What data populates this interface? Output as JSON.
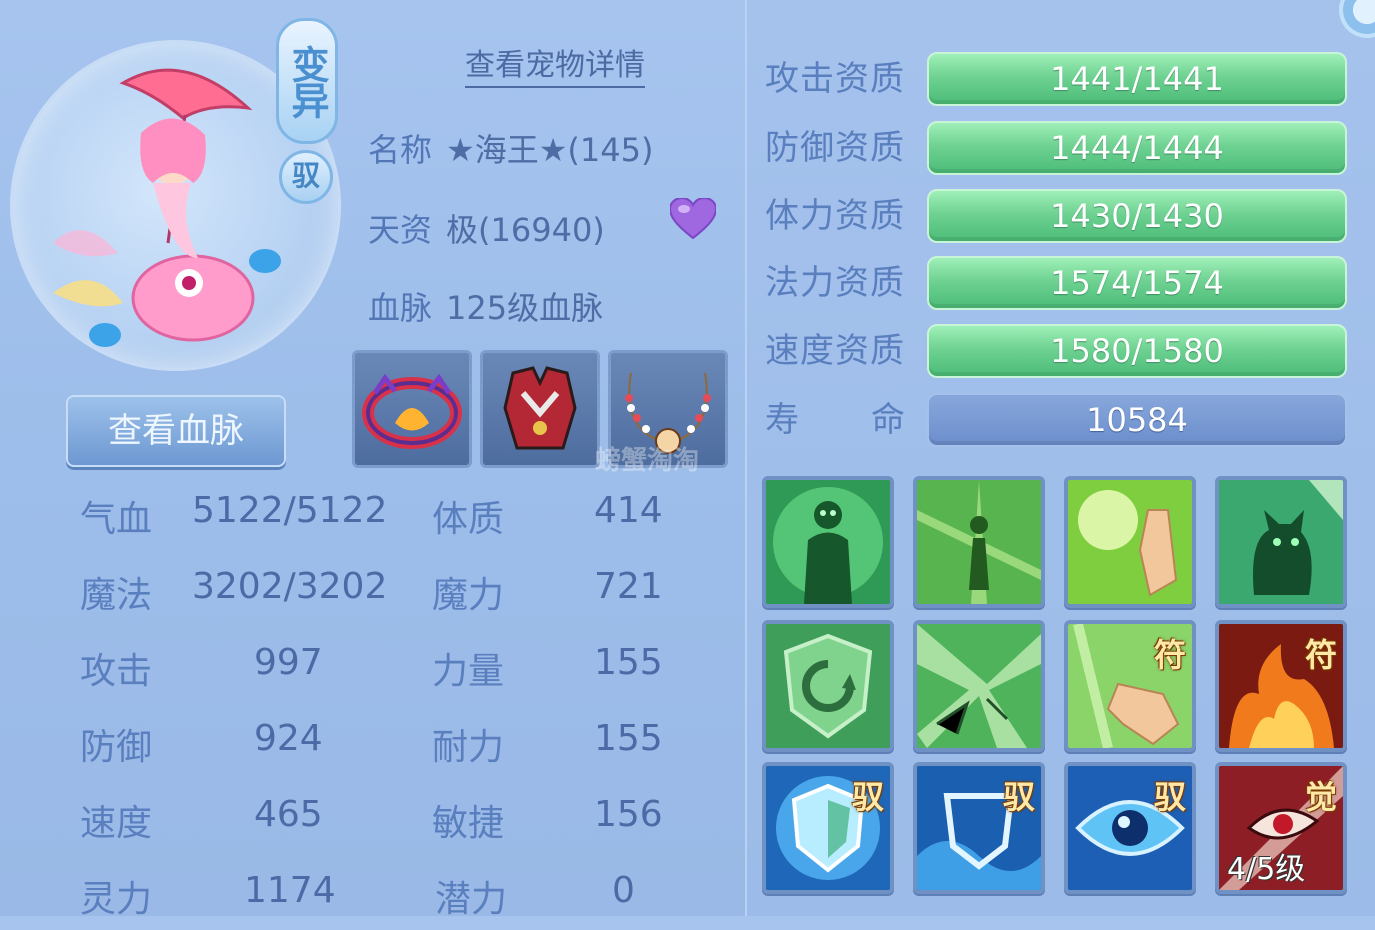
{
  "header": {
    "transform_badge": "变异",
    "ride_badge": "驭",
    "view_pet_details": "查看宠物详情"
  },
  "pet": {
    "name_label": "名称",
    "name_value": "★海王★(145)",
    "talent_label": "天资",
    "talent_value": "极(16940)",
    "bloodline_label": "血脉",
    "bloodline_value": "125级血脉",
    "heart_icon": "purple-heart-icon",
    "view_bloodline_button": "查看血脉"
  },
  "equipment": [
    {
      "icon": "collar-ring-icon"
    },
    {
      "icon": "armor-vest-icon"
    },
    {
      "icon": "bead-necklace-icon"
    }
  ],
  "watermark": "螃蟹淘淘",
  "stats": [
    {
      "label": "气血",
      "value": "5122/5122",
      "label2": "体质",
      "value2": "414"
    },
    {
      "label": "魔法",
      "value": "3202/3202",
      "label2": "魔力",
      "value2": "721"
    },
    {
      "label": "攻击",
      "value": "997",
      "label2": "力量",
      "value2": "155"
    },
    {
      "label": "防御",
      "value": "924",
      "label2": "耐力",
      "value2": "155"
    },
    {
      "label": "速度",
      "value": "465",
      "label2": "敏捷",
      "value2": "156"
    },
    {
      "label": "灵力",
      "value": "1174",
      "label2": "潜力",
      "value2": "0"
    }
  ],
  "aptitudes": [
    {
      "label": "攻击资质",
      "value": "1441/1441",
      "fill": 1.0
    },
    {
      "label": "防御资质",
      "value": "1444/1444",
      "fill": 1.0
    },
    {
      "label": "体力资质",
      "value": "1430/1430",
      "fill": 1.0
    },
    {
      "label": "法力资质",
      "value": "1574/1574",
      "fill": 1.0
    },
    {
      "label": "速度资质",
      "value": "1580/1580",
      "fill": 1.0
    }
  ],
  "lifespan": {
    "label_a": "寿",
    "label_b": "命",
    "value": "10584"
  },
  "skills": [
    {
      "icon": "green-humanoid-icon",
      "tag": "",
      "level": ""
    },
    {
      "icon": "glowing-figure-icon",
      "tag": "",
      "level": ""
    },
    {
      "icon": "palm-light-icon",
      "tag": "",
      "level": ""
    },
    {
      "icon": "green-cat-icon",
      "tag": "",
      "level": ""
    },
    {
      "icon": "shield-cycle-icon",
      "tag": "",
      "level": ""
    },
    {
      "icon": "crack-burst-icon",
      "tag": "",
      "level": ""
    },
    {
      "icon": "finger-sign-icon",
      "tag": "符",
      "level": ""
    },
    {
      "icon": "fire-icon",
      "tag": "符",
      "level": ""
    },
    {
      "icon": "blue-shield-icon",
      "tag": "驭",
      "level": ""
    },
    {
      "icon": "wave-shield-icon",
      "tag": "驭",
      "level": ""
    },
    {
      "icon": "blue-eye-icon",
      "tag": "驭",
      "level": ""
    },
    {
      "icon": "red-eye-icon",
      "tag": "觉",
      "level": "4/5级"
    }
  ]
}
